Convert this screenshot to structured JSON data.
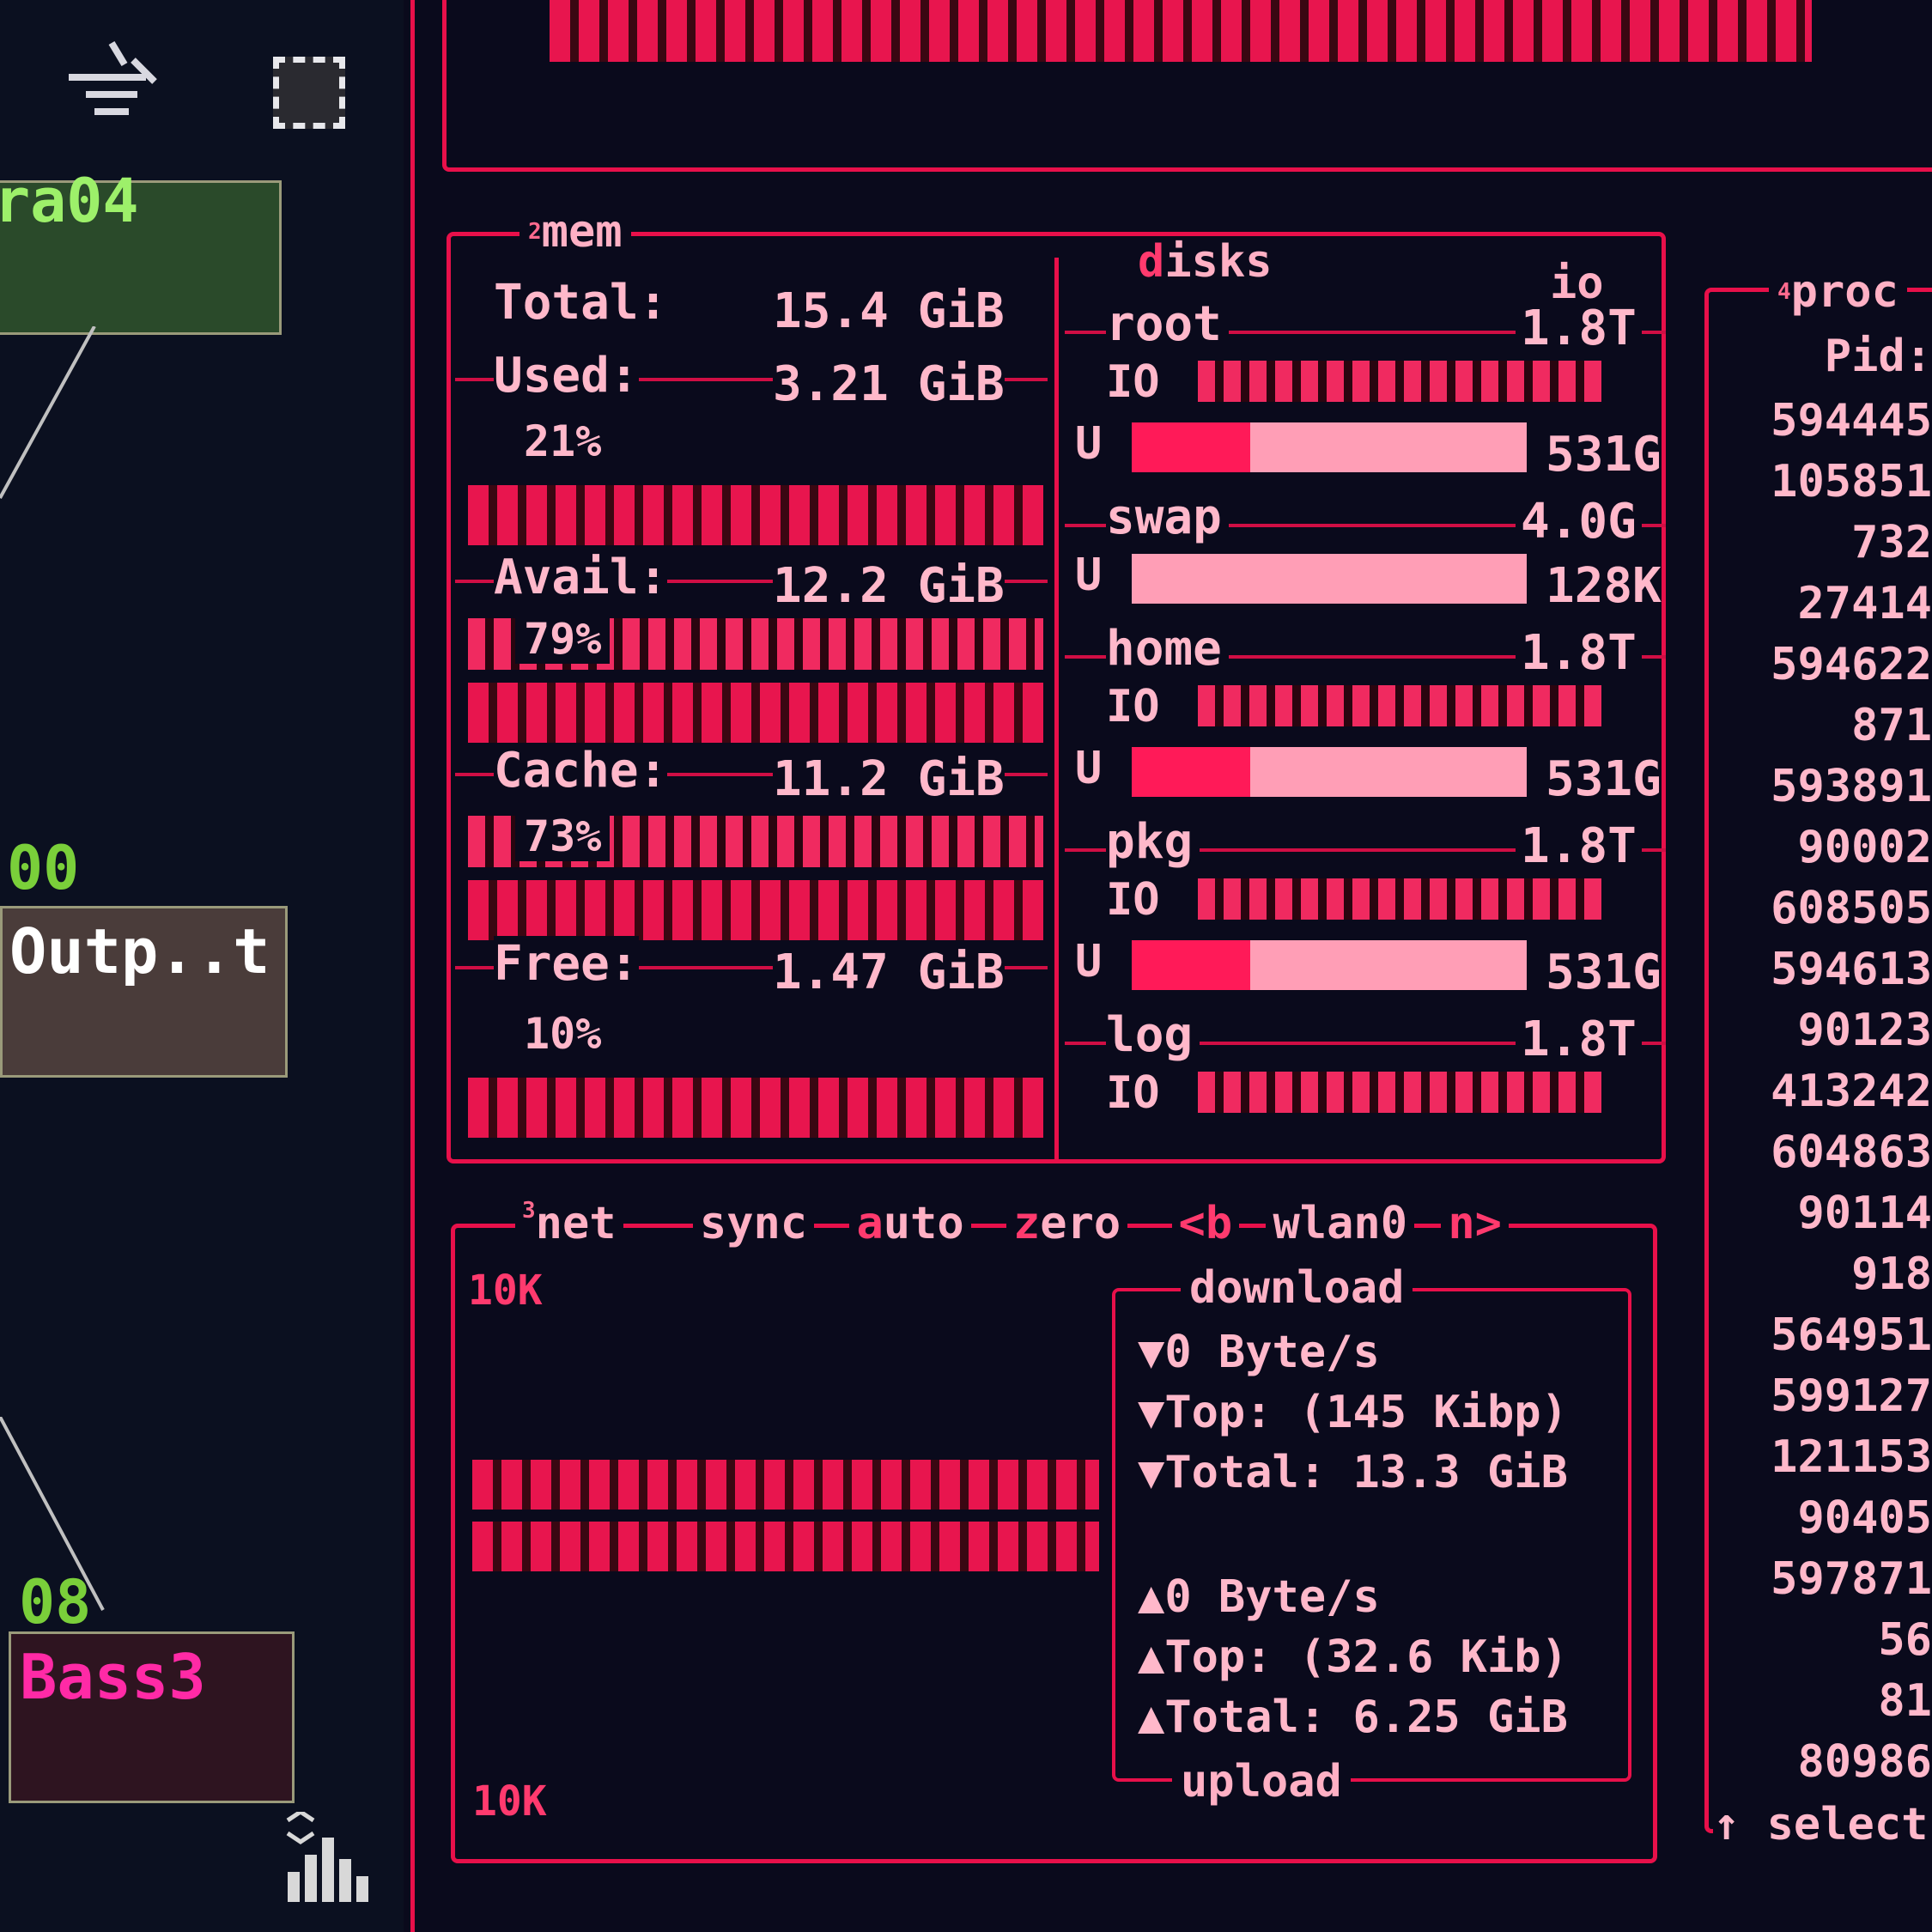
{
  "left_panel": {
    "node1_label": "ra04",
    "node2_channel": "00",
    "node2_label": "Outp..t",
    "node3_channel": "08",
    "node3_label": "Bass3"
  },
  "mem": {
    "title_num": "2",
    "title": "mem",
    "total_label": "Total:",
    "total_value": "15.4 GiB",
    "used_label": "Used:",
    "used_value": "3.21 GiB",
    "used_pct": "21%",
    "avail_label": "Avail:",
    "avail_value": "12.2 GiB",
    "avail_pct": "79%",
    "cache_label": "Cache:",
    "cache_value": "11.2 GiB",
    "cache_pct": "73%",
    "free_label": "Free:",
    "free_value": "1.47 GiB",
    "free_pct": "10%",
    "levels": {
      "used": 0.21,
      "avail": 0.79,
      "cache": 0.73,
      "free": 0.1
    }
  },
  "disks": {
    "title_first": "d",
    "title_rest": "isks",
    "io_label": "io",
    "io_row_label": "IO",
    "usage_row_label": "U",
    "items": [
      {
        "name": "root",
        "size": "1.8T",
        "used": "531G",
        "used_frac": 0.3
      },
      {
        "name": "swap",
        "size": "4.0G",
        "used": "128K",
        "used_frac": 0.0
      },
      {
        "name": "home",
        "size": "1.8T",
        "used": "531G",
        "used_frac": 0.3
      },
      {
        "name": "pkg",
        "size": "1.8T",
        "used": "531G",
        "used_frac": 0.3
      },
      {
        "name": "log",
        "size": "1.8T"
      }
    ]
  },
  "net": {
    "title_num": "3",
    "title": "net",
    "sync_label": "sync",
    "auto_first": "a",
    "auto_rest": "uto",
    "zero_first": "z",
    "zero_rest": "ero",
    "prev_key": "<b",
    "iface": "wlan0",
    "next_key": "n>",
    "scale_top": "10K",
    "scale_bottom": "10K",
    "download_title": "download",
    "download_rate": "0 Byte/s",
    "download_top": "Top: (145 Kibp)",
    "download_total": "Total: 13.3 GiB",
    "upload_rate": "0 Byte/s",
    "upload_top": "Top: (32.6 Kib)",
    "upload_total": "Total: 6.25 GiB",
    "upload_title": "upload"
  },
  "proc": {
    "title_num": "4",
    "title": "proc",
    "pid_header": "Pid:",
    "pids": [
      "594445",
      "105851",
      "732",
      "27414",
      "594622",
      "871",
      "593891",
      "90002",
      "608505",
      "594613",
      "90123",
      "413242",
      "604863",
      "90114",
      "918",
      "564951",
      "599127",
      "121153",
      "90405",
      "597871",
      "56",
      "81",
      "80986"
    ],
    "footer": "↑ select"
  },
  "colors": {
    "accent": "#e8104a",
    "text": "#ffb8ca",
    "background": "#0a0a1c"
  }
}
